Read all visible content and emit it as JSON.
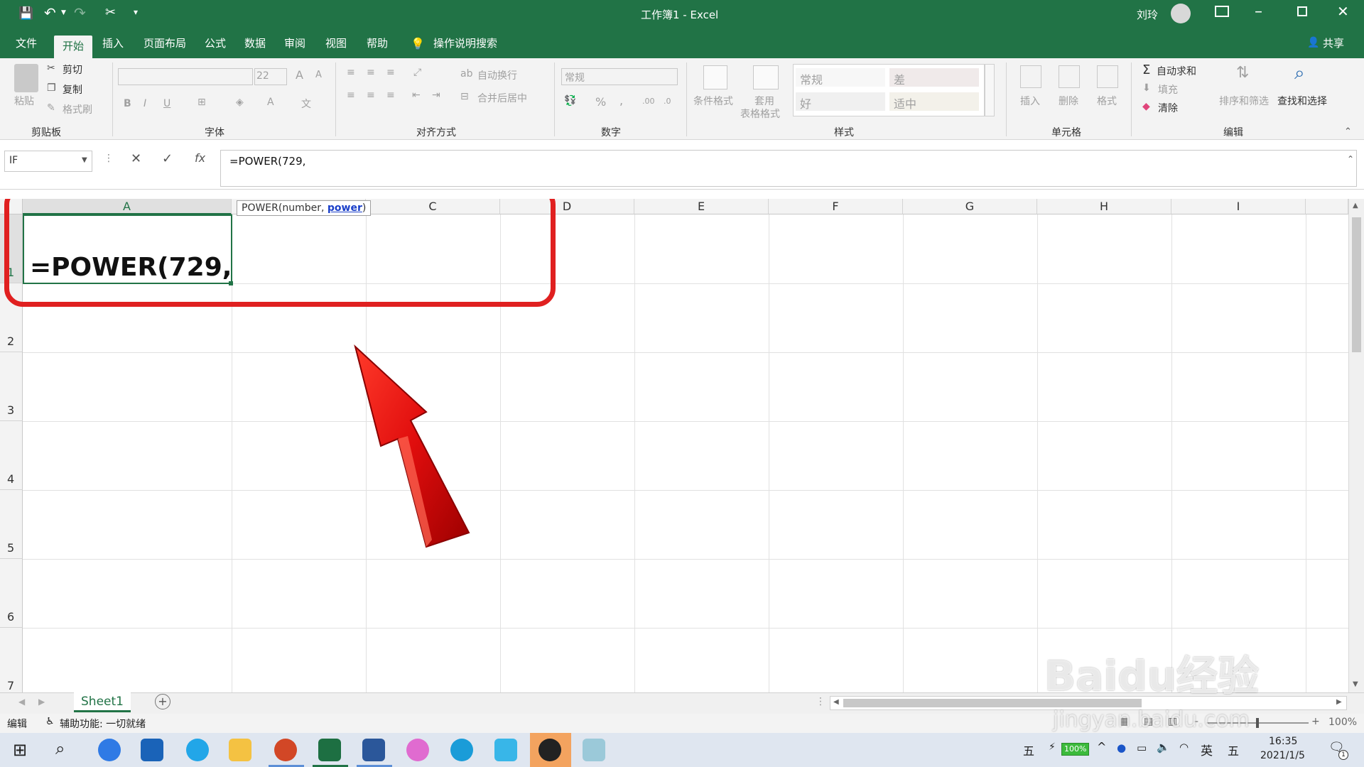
{
  "window": {
    "title": "工作簿1 - Excel",
    "user": "刘玲"
  },
  "menu": {
    "file": "文件",
    "home": "开始",
    "insert": "插入",
    "layout": "页面布局",
    "formulas": "公式",
    "data": "数据",
    "review": "审阅",
    "view": "视图",
    "help": "帮助",
    "tell_me": "操作说明搜索",
    "share": "共享"
  },
  "ribbon": {
    "clipboard": {
      "paste": "粘贴",
      "cut": "剪切",
      "copy": "复制",
      "format_painter": "格式刷",
      "label": "剪贴板"
    },
    "font": {
      "size": "22",
      "bold": "B",
      "italic": "I",
      "underline": "U",
      "grow": "A",
      "shrink": "A",
      "label": "字体"
    },
    "alignment": {
      "wrap": "自动换行",
      "merge": "合并后居中",
      "label": "对齐方式"
    },
    "number": {
      "format": "常规",
      "percent": "%",
      "comma": ",",
      "label": "数字"
    },
    "styles": {
      "conditional": "条件格式",
      "table_format_1": "套用",
      "table_format_2": "表格格式",
      "normal": "常规",
      "bad": "差",
      "good": "好",
      "neutral": "适中",
      "label": "样式"
    },
    "cells": {
      "insert": "插入",
      "delete": "删除",
      "format": "格式",
      "label": "单元格"
    },
    "editing": {
      "autosum": "自动求和",
      "fill": "填充",
      "clear": "清除",
      "sort_filter": "排序和筛选",
      "find_select": "查找和选择",
      "label": "编辑"
    }
  },
  "formula_bar": {
    "name_box": "IF",
    "cancel": "✕",
    "enter": "✓",
    "fx": "fx",
    "formula": "=POWER(729,"
  },
  "grid": {
    "columns": [
      "A",
      "B",
      "C",
      "D",
      "E",
      "F",
      "G",
      "H",
      "I"
    ],
    "rows": [
      "1",
      "2",
      "3",
      "4",
      "5",
      "6",
      "7"
    ],
    "active_cell_text": "=POWER(729,",
    "tooltip_prefix": "POWER(number, ",
    "tooltip_active_arg": "power",
    "tooltip_suffix": ")"
  },
  "sheets": {
    "tab": "Sheet1",
    "add": "+"
  },
  "status": {
    "mode": "编辑",
    "accessibility": "辅助功能: 一切就绪",
    "zoom": "100%"
  },
  "watermark": {
    "logo": "Baidu经验",
    "url": "jingyan.baidu.com"
  },
  "taskbar": {
    "time": "16:35",
    "date": "2021/1/5",
    "ime": "英",
    "ime2": "五",
    "battery": "100%",
    "notify": "1"
  },
  "colors": {
    "excel_green": "#217346",
    "highlight_red": "#e02020"
  }
}
